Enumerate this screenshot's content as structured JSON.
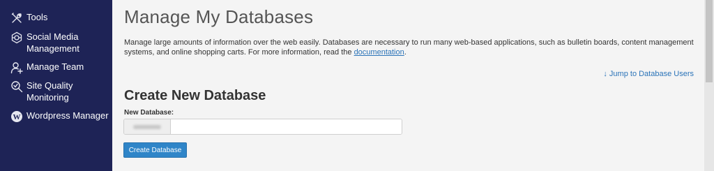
{
  "sidebar": {
    "items": [
      {
        "label": "Tools",
        "icon": "tools-icon"
      },
      {
        "label": "Social Media Management",
        "icon": "social-media-icon"
      },
      {
        "label": "Manage Team",
        "icon": "manage-team-icon"
      },
      {
        "label": "Site Quality Monitoring",
        "icon": "site-quality-icon"
      },
      {
        "label": "Wordpress Manager",
        "icon": "wordpress-icon"
      }
    ]
  },
  "main": {
    "title": "Manage My Databases",
    "description": "Manage large amounts of information over the web easily. Databases are necessary to run many web-based applications, such as bulletin boards, content management systems, and online shopping carts. For more information, read the",
    "doc_link": "documentation",
    "jump_link": "↓ Jump to Database Users",
    "section_title": "Create New Database",
    "field_label": "New Database:",
    "input_value": "",
    "button_label": "Create Database"
  },
  "colors": {
    "sidebar_bg": "#1e2356",
    "link": "#2a73b8",
    "button": "#2f85c8"
  }
}
